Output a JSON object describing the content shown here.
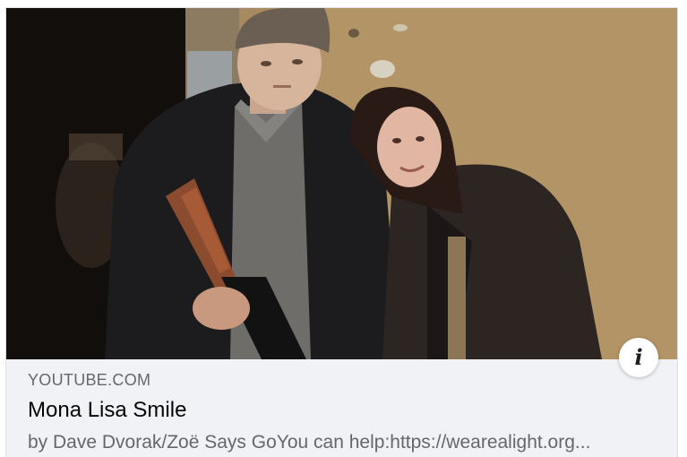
{
  "link_card": {
    "thumbnail": {
      "description_icon": "photo-thumbnail"
    },
    "info_button": {
      "icon": "info-icon",
      "glyph": "i"
    },
    "domain": "YOUTUBE.COM",
    "title": "Mona Lisa Smile",
    "description": "by Dave Dvorak/Zoë Says GoYou can help:https://wearealight.org..."
  },
  "colors": {
    "card_background": "#f0f2f5",
    "domain_text": "#65676b",
    "title_text": "#050505",
    "description_text": "#65676b"
  }
}
